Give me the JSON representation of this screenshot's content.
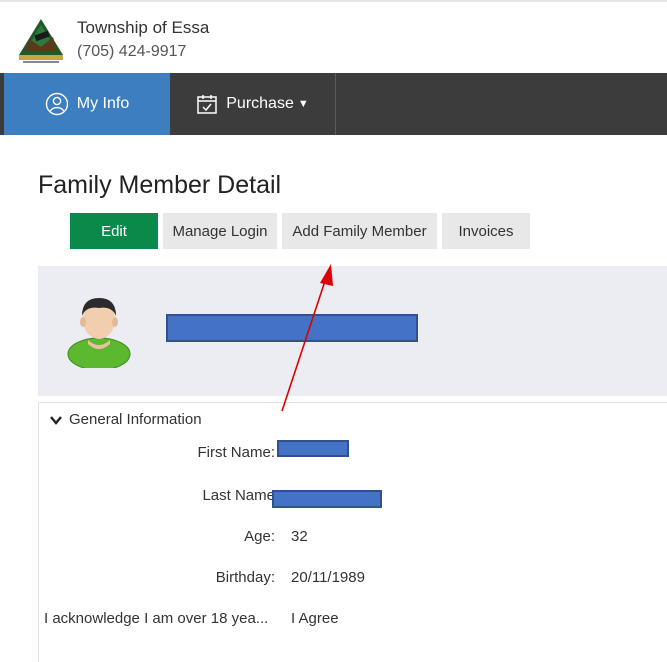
{
  "header": {
    "org_name": "Township of Essa",
    "phone": "(705) 424-9917"
  },
  "nav": {
    "my_info": "My Info",
    "purchase": "Purchase",
    "purchase_caret": "▼"
  },
  "page": {
    "title": "Family Member Detail"
  },
  "actions": {
    "edit": "Edit",
    "manage_login": "Manage Login",
    "add_family_member": "Add Family Member",
    "invoices": "Invoices"
  },
  "general": {
    "section_title": "General Information",
    "fields": [
      {
        "label": "First Name:",
        "value": ""
      },
      {
        "label": "Last Name",
        "value": ""
      },
      {
        "label": "Age:",
        "value": "32"
      },
      {
        "label": "Birthday:",
        "value": "20/11/1989"
      },
      {
        "label": "I acknowledge I am over 18 yea...",
        "value": "I Agree"
      }
    ]
  },
  "colors": {
    "nav_bg": "#3c3c3c",
    "nav_active": "#3d7ec1",
    "edit_button": "#0a8a4a",
    "redaction": "#4472c4",
    "annotation_arrow": "#e00000"
  },
  "icons": {
    "my_info": "user-circle-icon",
    "purchase": "calendar-check-icon",
    "section": "chevron-down-icon"
  }
}
